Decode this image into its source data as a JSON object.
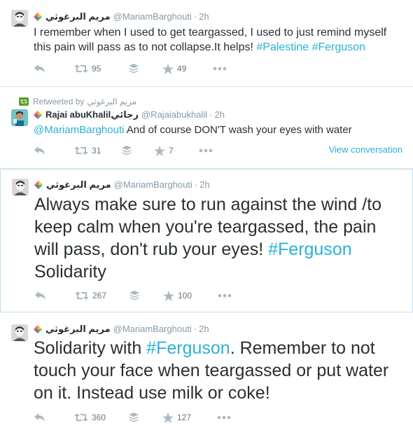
{
  "tweets": [
    {
      "fullname": "مريم البرغوثي",
      "username": "@MariamBarghouti",
      "sep": "·",
      "time": "2h",
      "text_parts": [
        "I remember when I used to get teargassed, I used to just remind myself this pain will pass as to not collapse.It helps! ",
        "#Palestine",
        " ",
        "#Ferguson"
      ],
      "retweets": "95",
      "favorites": "49"
    },
    {
      "context": {
        "label": "Retweeted by",
        "name": "مريم البرغوثي"
      },
      "fullname": "Rajai abuKhalilرجائي",
      "username": "@Rajaiabukhalil",
      "sep": "·",
      "time": "2h",
      "text_parts": [
        "@MariamBarghouti",
        " And of course DON'T wash your eyes with water"
      ],
      "retweets": "31",
      "favorites": "7",
      "view_conversation": "View conversation"
    },
    {
      "fullname": "مريم البرغوثي",
      "username": "@MariamBarghouti",
      "sep": "·",
      "time": "2h",
      "text_parts": [
        "Always make sure to run against the wind /to keep calm when you're teargassed, the pain will pass, don't rub your eyes! ",
        "#Ferguson",
        " Solidarity"
      ],
      "retweets": "267",
      "favorites": "100"
    },
    {
      "fullname": "مريم البرغوثي",
      "username": "@MariamBarghouti",
      "sep": "·",
      "time": "2h",
      "text_parts": [
        "Solidarity with ",
        "#Ferguson",
        ". Remember to not touch your face when teargassed or put water on it. Instead use milk or coke!"
      ],
      "retweets": "360",
      "favorites": "127"
    }
  ],
  "colors": {
    "link": "#2ab1d5",
    "meta": "#8899a6",
    "text": "#292f33",
    "retweet_badge": "#5c9e31"
  },
  "icons": [
    "reply-icon",
    "retweet-icon",
    "buffer-icon",
    "favorite-icon",
    "more-icon",
    "verified-mark-icon"
  ]
}
